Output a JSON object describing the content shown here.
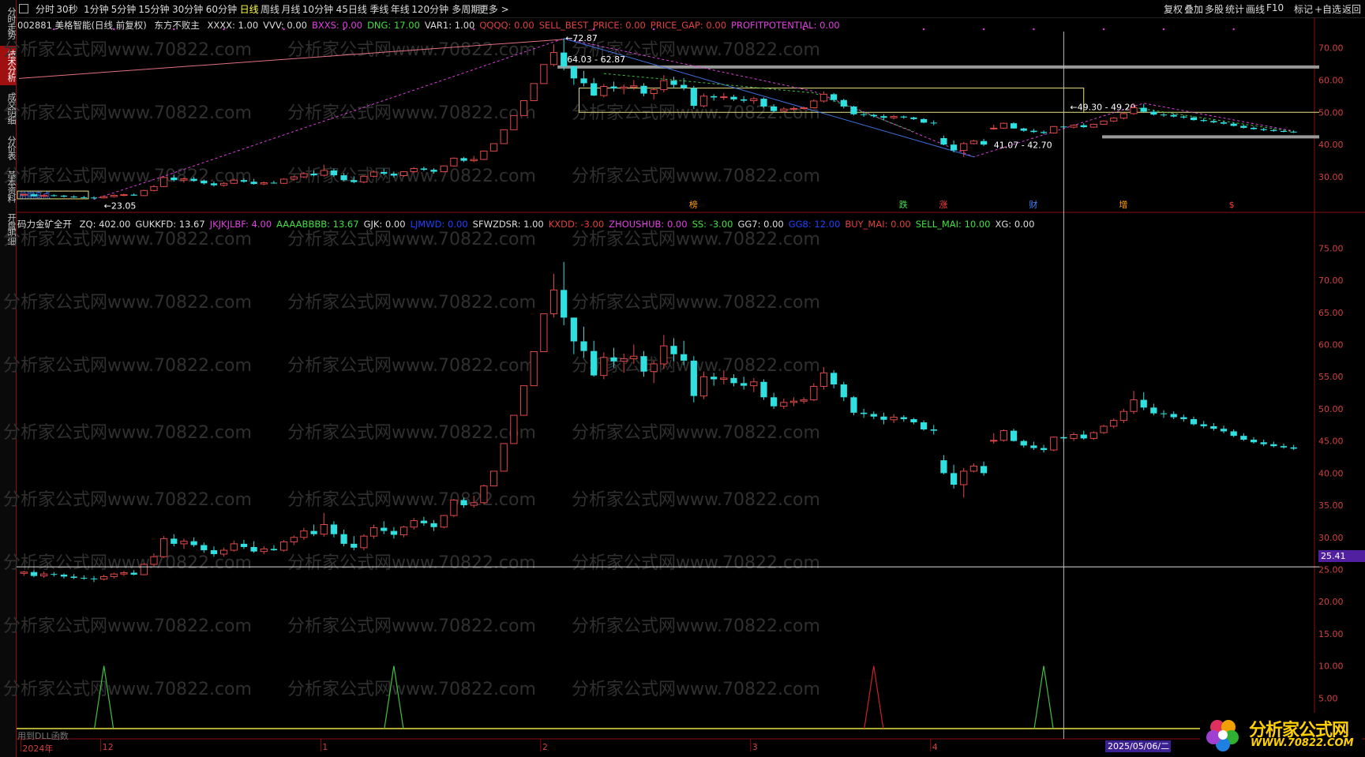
{
  "left_tabs": [
    {
      "label": "分时走势",
      "active": false
    },
    {
      "label": "技术分析",
      "active": true
    },
    {
      "label": "成交明细",
      "active": false
    },
    {
      "label": "分价表",
      "active": false
    },
    {
      "label": "基本资料",
      "active": false
    },
    {
      "label": "开盘明细",
      "active": false
    }
  ],
  "toolbar": {
    "periods": [
      "分时",
      "30秒",
      "1分钟",
      "5分钟",
      "15分钟",
      "30分钟",
      "60分钟",
      "日线",
      "周线",
      "月线",
      "10分钟",
      "45日线",
      "季线",
      "年线",
      "120分钟",
      "多周期",
      "更多 >"
    ],
    "active_period": "日线",
    "right_buttons": [
      "复权",
      "叠加",
      "多股",
      "统计",
      "画线",
      "F10",
      "标记",
      "+自选",
      "返回"
    ]
  },
  "info_main": {
    "stock": "002881 美格智能(日线 前复权)",
    "indicator": "东方不败主",
    "items": [
      {
        "text": "XXXX: 1.00",
        "color": "#dddddd"
      },
      {
        "text": "VVV: 0.00",
        "color": "#dddddd"
      },
      {
        "text": "BXXS: 0.00",
        "color": "#e040e0"
      },
      {
        "text": "DNG: 17.00",
        "color": "#40e040"
      },
      {
        "text": "VAR1: 1.00",
        "color": "#dddddd"
      },
      {
        "text": "QQQQ: 0.00",
        "color": "#e04040"
      },
      {
        "text": "SELL_BEST_PRICE: 0.00",
        "color": "#e04040"
      },
      {
        "text": "PRICE_GAP: 0.00",
        "color": "#e04040"
      },
      {
        "text": "PROFITPOTENTIAL: 0.00",
        "color": "#e040e0"
      }
    ]
  },
  "info_sub": {
    "indicator": "码力金矿全开",
    "items": [
      {
        "text": "ZQ: 402.00",
        "color": "#dddddd"
      },
      {
        "text": "GUKKFD: 13.67",
        "color": "#dddddd"
      },
      {
        "text": "JKJKJLBF: 4.00",
        "color": "#e040e0"
      },
      {
        "text": "AAAABBBB: 13.67",
        "color": "#40e040"
      },
      {
        "text": "GJK: 0.00",
        "color": "#dddddd"
      },
      {
        "text": "LJMWD: 0.00",
        "color": "#2040ff"
      },
      {
        "text": "SFWZDSR: 1.00",
        "color": "#dddddd"
      },
      {
        "text": "KXDD: -3.00",
        "color": "#e04040"
      },
      {
        "text": "ZHOUSHUB: 0.00",
        "color": "#e040e0"
      },
      {
        "text": "SS: -3.00",
        "color": "#40e040"
      },
      {
        "text": "GG7: 0.00",
        "color": "#dddddd"
      },
      {
        "text": "GG8: 12.00",
        "color": "#2040ff"
      },
      {
        "text": "BUY_MAI: 0.00",
        "color": "#e04040"
      },
      {
        "text": "SELL_MAI: 10.00",
        "color": "#40e040"
      },
      {
        "text": "XG: 0.00",
        "color": "#dddddd"
      }
    ]
  },
  "y_axis_main": [
    "70.00",
    "60.00",
    "50.00",
    "40.00",
    "30.00"
  ],
  "y_axis_sub": [
    "75.00",
    "70.00",
    "65.00",
    "60.00",
    "55.00",
    "50.00",
    "45.00",
    "40.00",
    "35.00",
    "30.00",
    "25.00",
    "20.00",
    "15.00",
    "10.00",
    "5.00"
  ],
  "annotations": {
    "high": "72.87",
    "low": "23.05",
    "zone_top": "64.03 - 62.87",
    "zone_bottom": "41.07 - 42.70",
    "zone_right": "49.30 - 49.20",
    "box_label": "前期高点"
  },
  "event_marks": [
    {
      "text": "榜",
      "color": "#ffa000"
    },
    {
      "text": "跌",
      "color": "#40e040"
    },
    {
      "text": "涨",
      "color": "#ff4040"
    },
    {
      "text": "财",
      "color": "#4080ff"
    },
    {
      "text": "增",
      "color": "#ffa000"
    },
    {
      "text": "$",
      "color": "#ff4040"
    }
  ],
  "price_tag": "25.41",
  "x_axis": [
    "2024年",
    "12",
    "1",
    "2",
    "3",
    "4"
  ],
  "cursor_date": "2025/05/06/二",
  "footer_note": "用到DLL函数",
  "watermark": "分析家公式网www.70822.com",
  "logo": {
    "title": "分析家公式网",
    "url": "WWW.70822.COM"
  },
  "chart_data": {
    "type": "candlestick",
    "series": [
      {
        "name": "美格智能",
        "ohlc": [
          [
            24.4,
            24.8,
            24.0,
            24.6
          ],
          [
            24.6,
            24.9,
            23.8,
            24.0
          ],
          [
            24.0,
            24.7,
            23.7,
            24.3
          ],
          [
            24.3,
            24.6,
            23.9,
            24.2
          ],
          [
            24.2,
            24.4,
            23.6,
            23.9
          ],
          [
            23.9,
            24.3,
            23.5,
            23.7
          ],
          [
            23.7,
            24.1,
            23.4,
            23.6
          ],
          [
            23.6,
            24.0,
            23.05,
            23.5
          ],
          [
            23.5,
            24.2,
            23.3,
            23.9
          ],
          [
            23.9,
            24.5,
            23.6,
            24.3
          ],
          [
            24.3,
            24.8,
            24.0,
            24.5
          ],
          [
            24.5,
            24.9,
            24.1,
            24.2
          ],
          [
            24.2,
            26.0,
            24.1,
            25.8
          ],
          [
            25.8,
            27.5,
            25.5,
            27.0
          ],
          [
            27.0,
            30.2,
            26.8,
            29.8
          ],
          [
            29.8,
            30.5,
            28.6,
            29.0
          ],
          [
            29.0,
            29.8,
            28.2,
            29.4
          ],
          [
            29.4,
            30.0,
            28.5,
            28.8
          ],
          [
            28.8,
            29.2,
            27.6,
            28.0
          ],
          [
            28.0,
            28.6,
            27.0,
            27.4
          ],
          [
            27.4,
            28.4,
            27.0,
            28.0
          ],
          [
            28.0,
            29.5,
            27.8,
            29.0
          ],
          [
            29.0,
            29.6,
            28.2,
            28.5
          ],
          [
            28.5,
            29.4,
            27.6,
            27.8
          ],
          [
            27.8,
            28.6,
            27.4,
            28.2
          ],
          [
            28.2,
            28.8,
            27.9,
            28.0
          ],
          [
            28.0,
            29.6,
            27.8,
            29.3
          ],
          [
            29.3,
            30.3,
            28.8,
            30.0
          ],
          [
            30.0,
            31.5,
            29.6,
            31.0
          ],
          [
            31.0,
            32.0,
            30.2,
            30.5
          ],
          [
            30.5,
            33.8,
            30.1,
            32.0
          ],
          [
            32.0,
            32.5,
            30.0,
            30.5
          ],
          [
            30.5,
            31.2,
            28.6,
            29.0
          ],
          [
            29.0,
            30.2,
            28.0,
            28.4
          ],
          [
            28.4,
            30.5,
            28.0,
            30.2
          ],
          [
            30.2,
            32.0,
            29.8,
            31.5
          ],
          [
            31.5,
            32.5,
            30.5,
            31.0
          ],
          [
            31.0,
            31.6,
            29.8,
            30.4
          ],
          [
            30.4,
            31.8,
            30.0,
            31.6
          ],
          [
            31.6,
            33.0,
            31.2,
            32.6
          ],
          [
            32.6,
            33.2,
            31.8,
            32.2
          ],
          [
            32.2,
            32.7,
            31.0,
            31.6
          ],
          [
            31.6,
            33.5,
            31.4,
            33.4
          ],
          [
            33.4,
            36.0,
            33.2,
            35.8
          ],
          [
            35.8,
            36.2,
            34.6,
            35.0
          ],
          [
            35.0,
            36.5,
            34.6,
            35.4
          ],
          [
            35.4,
            38.2,
            35.2,
            38.0
          ],
          [
            38.0,
            40.3,
            38.0,
            40.3
          ],
          [
            40.3,
            44.6,
            40.3,
            44.6
          ],
          [
            44.6,
            49.0,
            44.6,
            49.0
          ],
          [
            49.0,
            53.6,
            49.0,
            53.6
          ],
          [
            53.6,
            58.9,
            53.6,
            58.9
          ],
          [
            58.9,
            64.8,
            58.9,
            64.8
          ],
          [
            64.8,
            71.0,
            64.2,
            68.5
          ],
          [
            68.5,
            72.87,
            63.0,
            64.2
          ],
          [
            64.2,
            63.5,
            58.5,
            60.5
          ],
          [
            60.5,
            62.8,
            58.0,
            59.0
          ],
          [
            59.0,
            60.6,
            55.0,
            55.2
          ],
          [
            55.2,
            58.8,
            54.6,
            58.0
          ],
          [
            58.0,
            59.5,
            56.4,
            57.4
          ],
          [
            57.4,
            58.6,
            55.6,
            57.8
          ],
          [
            57.8,
            60.0,
            57.0,
            58.2
          ],
          [
            58.2,
            59.0,
            55.0,
            55.8
          ],
          [
            55.8,
            57.5,
            54.0,
            57.0
          ],
          [
            57.0,
            61.5,
            56.2,
            59.8
          ],
          [
            59.8,
            61.0,
            57.4,
            58.5
          ],
          [
            58.5,
            60.6,
            56.8,
            57.5
          ],
          [
            57.5,
            58.2,
            51.0,
            52.0
          ],
          [
            52.0,
            55.8,
            51.5,
            55.0
          ],
          [
            55.0,
            55.6,
            53.6,
            54.6
          ],
          [
            54.6,
            56.0,
            53.8,
            54.8
          ],
          [
            54.8,
            55.4,
            53.5,
            54.0
          ],
          [
            54.0,
            55.0,
            53.0,
            53.6
          ],
          [
            53.6,
            54.8,
            52.6,
            54.2
          ],
          [
            54.2,
            54.6,
            51.4,
            51.8
          ],
          [
            51.8,
            52.5,
            50.0,
            50.4
          ],
          [
            50.4,
            51.6,
            50.0,
            51.0
          ],
          [
            51.0,
            51.8,
            50.4,
            51.2
          ],
          [
            51.2,
            51.8,
            50.8,
            51.4
          ],
          [
            51.4,
            54.0,
            51.2,
            53.5
          ],
          [
            53.5,
            56.5,
            53.0,
            55.6
          ],
          [
            55.6,
            56.0,
            53.2,
            53.8
          ],
          [
            53.8,
            54.2,
            51.2,
            51.8
          ],
          [
            51.8,
            52.0,
            49.0,
            49.4
          ],
          [
            49.4,
            50.0,
            48.6,
            49.2
          ],
          [
            49.2,
            49.6,
            48.4,
            48.8
          ],
          [
            48.8,
            49.4,
            47.6,
            48.3
          ],
          [
            48.3,
            49.2,
            47.8,
            48.7
          ],
          [
            48.7,
            49.0,
            48.0,
            48.4
          ],
          [
            48.4,
            48.6,
            47.6,
            47.9
          ],
          [
            47.9,
            48.2,
            46.6,
            46.8
          ],
          [
            46.8,
            47.5,
            46.0,
            46.6
          ],
          [
            42.0,
            42.8,
            39.8,
            40.0
          ],
          [
            40.0,
            41.3,
            37.6,
            38.2
          ],
          [
            38.2,
            40.8,
            36.2,
            40.3
          ],
          [
            40.3,
            41.5,
            40.1,
            41.1
          ],
          [
            41.1,
            41.8,
            39.6,
            40.0
          ],
          [
            45.0,
            46.2,
            44.6,
            45.1
          ],
          [
            45.1,
            46.8,
            44.9,
            46.6
          ],
          [
            46.6,
            46.9,
            44.9,
            45.0
          ],
          [
            45.0,
            45.2,
            44.0,
            44.3
          ],
          [
            44.3,
            44.9,
            43.6,
            43.9
          ],
          [
            43.9,
            44.4,
            43.2,
            43.6
          ],
          [
            43.6,
            45.7,
            43.4,
            45.6
          ],
          [
            45.6,
            46.0,
            44.8,
            45.4
          ],
          [
            45.4,
            46.3,
            45.0,
            46.0
          ],
          [
            46.0,
            46.6,
            45.2,
            45.4
          ],
          [
            45.4,
            46.5,
            45.2,
            46.3
          ],
          [
            46.3,
            47.5,
            46.1,
            47.3
          ],
          [
            47.3,
            48.5,
            47.0,
            48.2
          ],
          [
            48.2,
            50.0,
            47.8,
            49.6
          ],
          [
            49.6,
            52.8,
            49.2,
            51.4
          ],
          [
            51.4,
            52.6,
            49.8,
            50.2
          ],
          [
            50.2,
            50.8,
            49.0,
            49.3
          ],
          [
            49.3,
            49.8,
            48.6,
            49.2
          ],
          [
            49.2,
            49.6,
            48.4,
            48.7
          ],
          [
            48.7,
            49.1,
            48.0,
            48.4
          ],
          [
            48.4,
            48.8,
            47.4,
            47.6
          ],
          [
            47.6,
            48.1,
            47.0,
            47.3
          ],
          [
            47.3,
            47.8,
            46.6,
            46.9
          ],
          [
            46.9,
            47.4,
            46.2,
            46.5
          ],
          [
            46.5,
            46.8,
            45.6,
            45.8
          ],
          [
            45.8,
            46.2,
            45.0,
            45.2
          ],
          [
            45.2,
            45.6,
            44.6,
            44.8
          ],
          [
            44.8,
            45.2,
            44.2,
            44.5
          ],
          [
            44.5,
            44.9,
            44.0,
            44.2
          ],
          [
            44.2,
            44.6,
            43.8,
            44.0
          ],
          [
            44.0,
            44.4,
            43.6,
            43.8
          ]
        ]
      }
    ],
    "signal_spikes": [
      {
        "index": 8,
        "color": "#40c040"
      },
      {
        "index": 37,
        "color": "#40c040"
      },
      {
        "index": 85,
        "color": "#d02020"
      },
      {
        "index": 102,
        "color": "#40c040"
      }
    ],
    "main_ylim": [
      20,
      75
    ],
    "sub_ylim": [
      0,
      78
    ]
  }
}
